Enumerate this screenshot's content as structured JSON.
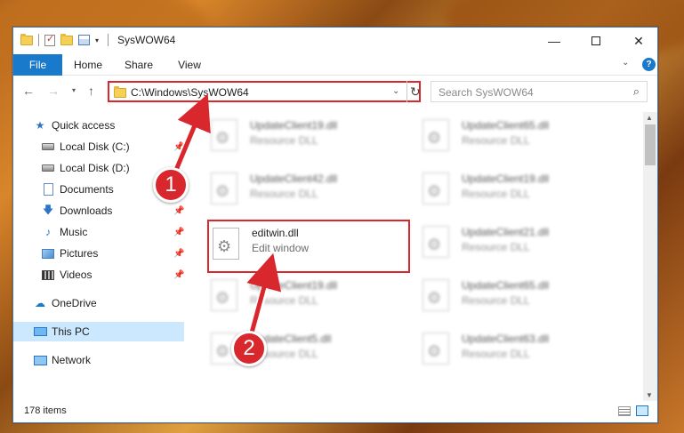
{
  "window": {
    "title": "SysWOW64"
  },
  "ribbon": {
    "tabs": [
      "File",
      "Home",
      "Share",
      "View"
    ],
    "help_label": "?"
  },
  "address": {
    "path": "C:\\Windows\\SysWOW64"
  },
  "search": {
    "placeholder": "Search SysWOW64"
  },
  "sidebar": {
    "items": [
      {
        "label": "Quick access",
        "icon": "star-icon",
        "pinned": false
      },
      {
        "label": "Local Disk (C:)",
        "icon": "drive-icon",
        "pinned": true
      },
      {
        "label": "Local Disk (D:)",
        "icon": "drive-icon",
        "pinned": false
      },
      {
        "label": "Documents",
        "icon": "documents-icon",
        "pinned": true
      },
      {
        "label": "Downloads",
        "icon": "download-icon",
        "pinned": true
      },
      {
        "label": "Music",
        "icon": "music-icon",
        "pinned": true
      },
      {
        "label": "Pictures",
        "icon": "pictures-icon",
        "pinned": true
      },
      {
        "label": "Videos",
        "icon": "videos-icon",
        "pinned": true
      },
      {
        "label": "OneDrive",
        "icon": "cloud-icon",
        "pinned": false
      },
      {
        "label": "This PC",
        "icon": "computer-icon",
        "pinned": false,
        "selected": true
      },
      {
        "label": "Network",
        "icon": "network-icon",
        "pinned": false
      }
    ]
  },
  "files": [
    {
      "name": "UpdateClient19.dll",
      "type": "Resource DLL"
    },
    {
      "name": "UpdateClient65.dll",
      "type": "Resource DLL"
    },
    {
      "name": "UpdateClient42.dll",
      "type": "Resource DLL"
    },
    {
      "name": "UpdateClient19.dll",
      "type": "Resource DLL"
    },
    {
      "name": "editwin.dll",
      "type": "Edit window"
    },
    {
      "name": "UpdateClient21.dll",
      "type": "Resource DLL"
    },
    {
      "name": "UpdateClient19.dll",
      "type": "Resource DLL"
    },
    {
      "name": "UpdateClient65.dll",
      "type": "Resource DLL"
    },
    {
      "name": "UpdateClient5.dll",
      "type": "Resource DLL"
    },
    {
      "name": "UpdateClient63.dll",
      "type": "Resource DLL"
    }
  ],
  "status": {
    "item_count": "178 items"
  },
  "annotations": {
    "step1": "1",
    "step2": "2"
  },
  "colors": {
    "accent": "#1979ca",
    "highlight": "#d9272e",
    "selected": "#cce8ff"
  }
}
